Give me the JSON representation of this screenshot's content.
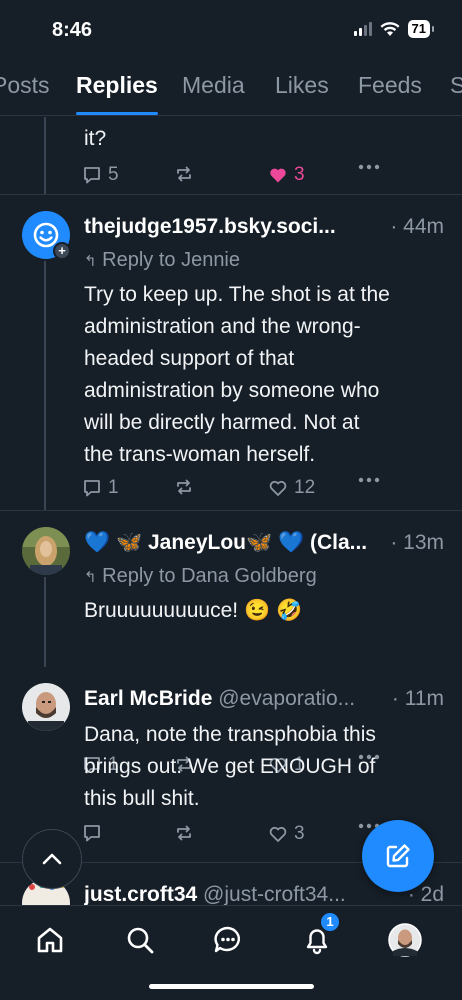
{
  "status_bar": {
    "time": "8:46",
    "battery": "71"
  },
  "tabs": [
    "Posts",
    "Replies",
    "Media",
    "Likes",
    "Feeds",
    "S"
  ],
  "active_tab": "Replies",
  "colors": {
    "accent": "#208bfe",
    "like": "#ec4899",
    "background": "#161e27",
    "muted": "#8d98a5"
  },
  "posts": [
    {
      "body": "it?",
      "replies": "5",
      "reposts": "",
      "likes": "3",
      "liked": true
    },
    {
      "name": "thejudge1957.bsky.soci...",
      "time": "· 44m",
      "reply_to": "Reply to Jennie",
      "body_lines": [
        "Try to keep up. The shot is at the",
        "administration and the wrong-",
        "headed support of that",
        "administration by someone who",
        "will be directly harmed. Not at",
        "the trans-woman herself."
      ],
      "replies": "1",
      "likes": "12",
      "avatar_icon": "smiley-face-icon"
    },
    {
      "name": "💙 🦋 JaneyLou🦋 💙 (Cla...",
      "time": "· 13m",
      "reply_to": "Reply to Dana Goldberg",
      "body": "Bruuuuuuuuuce! 😉 🤣",
      "replies": "1",
      "likes": "1"
    },
    {
      "name": "Earl McBride",
      "handle": "@evaporatio...",
      "time": "· 11m",
      "body_lines": [
        "Dana, note the transphobia this",
        "brings out. We get ENOUGH of",
        "this bull shit."
      ],
      "replies": "",
      "likes": "3"
    },
    {
      "name": "just.croft34",
      "handle": "@just-croft34...",
      "time": "· 2d"
    }
  ],
  "notifications_count": "1"
}
